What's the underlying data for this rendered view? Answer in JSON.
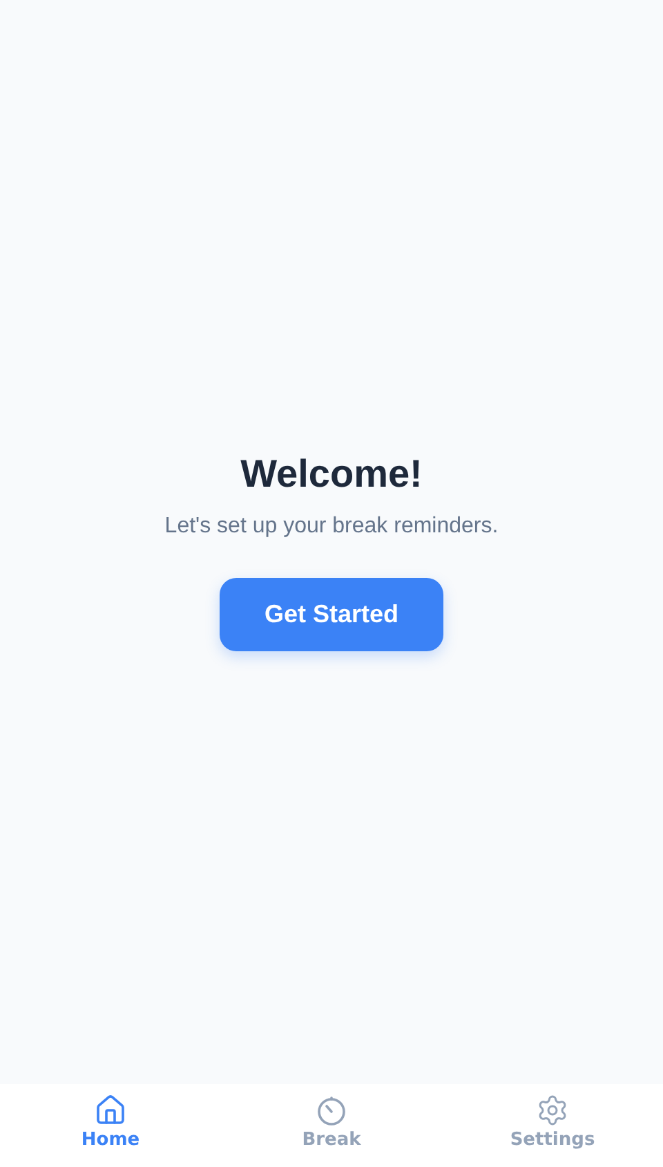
{
  "welcome": {
    "title": "Welcome!",
    "subtitle": "Let's set up your break reminders.",
    "button": "Get Started"
  },
  "nav": [
    {
      "kind": "home",
      "label": "Home",
      "selected": true
    },
    {
      "kind": "break",
      "label": "Break",
      "selected": false
    },
    {
      "kind": "settings",
      "label": "Settings",
      "selected": false
    }
  ]
}
